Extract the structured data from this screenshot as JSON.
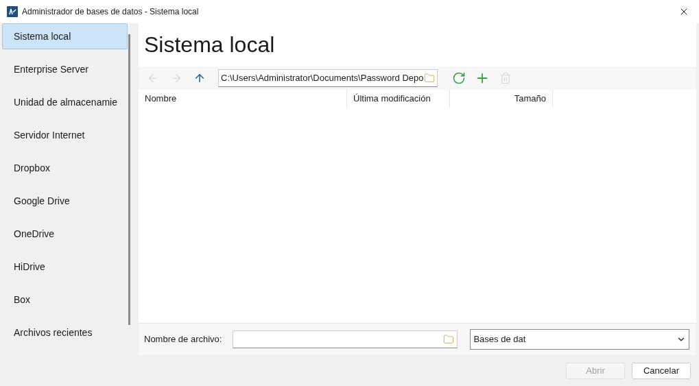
{
  "window": {
    "title": "Administrador de bases de datos - Sistema local"
  },
  "sidebar": {
    "items": [
      {
        "label": "Sistema local",
        "selected": true
      },
      {
        "label": "Enterprise Server",
        "selected": false
      },
      {
        "label": "Unidad de almacenamie",
        "selected": false
      },
      {
        "label": "Servidor Internet",
        "selected": false
      },
      {
        "label": "Dropbox",
        "selected": false
      },
      {
        "label": "Google Drive",
        "selected": false
      },
      {
        "label": "OneDrive",
        "selected": false
      },
      {
        "label": "HiDrive",
        "selected": false
      },
      {
        "label": "Box",
        "selected": false
      },
      {
        "label": "Archivos recientes",
        "selected": false
      }
    ]
  },
  "heading": "Sistema local",
  "toolbar": {
    "back_disabled": true,
    "forward_disabled": true,
    "path": "C:\\Users\\Administrator\\Documents\\Password Depo",
    "delete_disabled": true
  },
  "table": {
    "columns": [
      "Nombre",
      "Última modificación",
      "Tamaño"
    ]
  },
  "file_name": {
    "label": "Nombre de archivo:"
  },
  "file_type": {
    "value": "Bases de dat"
  },
  "buttons": [
    {
      "label": "Abrir",
      "disabled": true
    },
    {
      "label": "Cancelar",
      "disabled": false
    }
  ]
}
